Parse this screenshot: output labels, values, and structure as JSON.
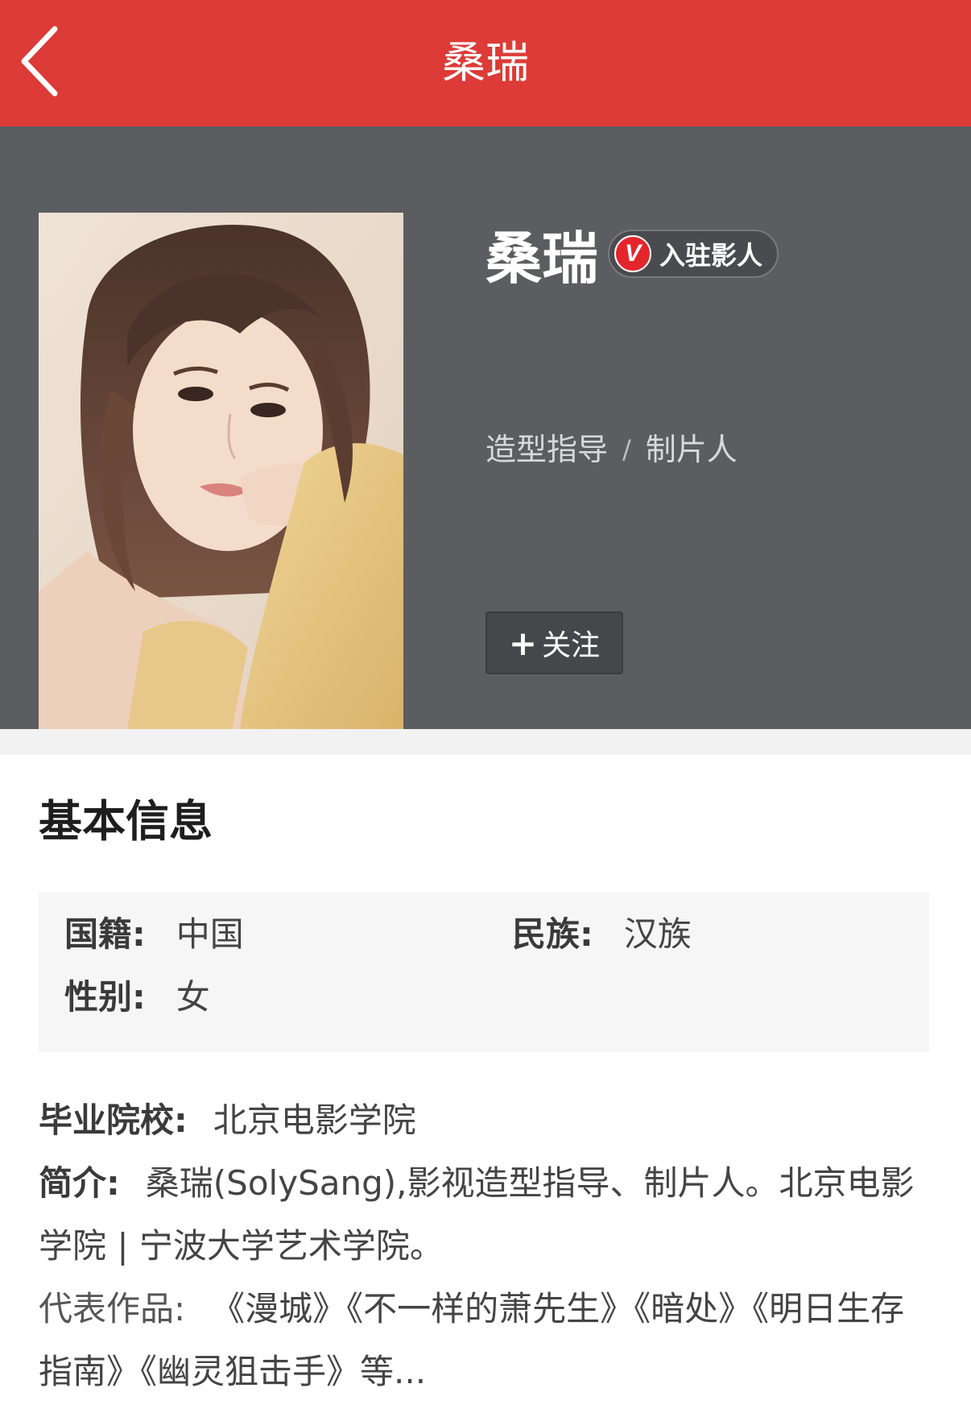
{
  "topbar": {
    "title": "桑瑞",
    "back_icon": "chevron-left-icon",
    "color": "#dc3b37"
  },
  "profile": {
    "name": "桑瑞",
    "badge": {
      "icon_letter": "V",
      "label": "入驻影人",
      "color": "#e3262c"
    },
    "roles": [
      "造型指导",
      "制片人"
    ],
    "role_separator": "/",
    "follow_button": {
      "icon": "+",
      "label": "关注"
    }
  },
  "basic_info": {
    "title": "基本信息",
    "nationality": {
      "label": "国籍:",
      "value": "中国"
    },
    "ethnicity": {
      "label": "民族:",
      "value": "汉族"
    },
    "gender": {
      "label": "性别:",
      "value": "女"
    }
  },
  "details": {
    "school": {
      "label": "毕业院校:",
      "value": "北京电影学院"
    },
    "intro": {
      "label": "简介:",
      "value": "桑瑞(SolySang),影视造型指导、制片人。北京电影学院 | 宁波大学艺术学院。"
    },
    "works": {
      "label": "代表作品:",
      "value": "《漫城》《不一样的萧先生》《暗处》《明日生存指南》《幽灵狙击手》等..."
    }
  }
}
